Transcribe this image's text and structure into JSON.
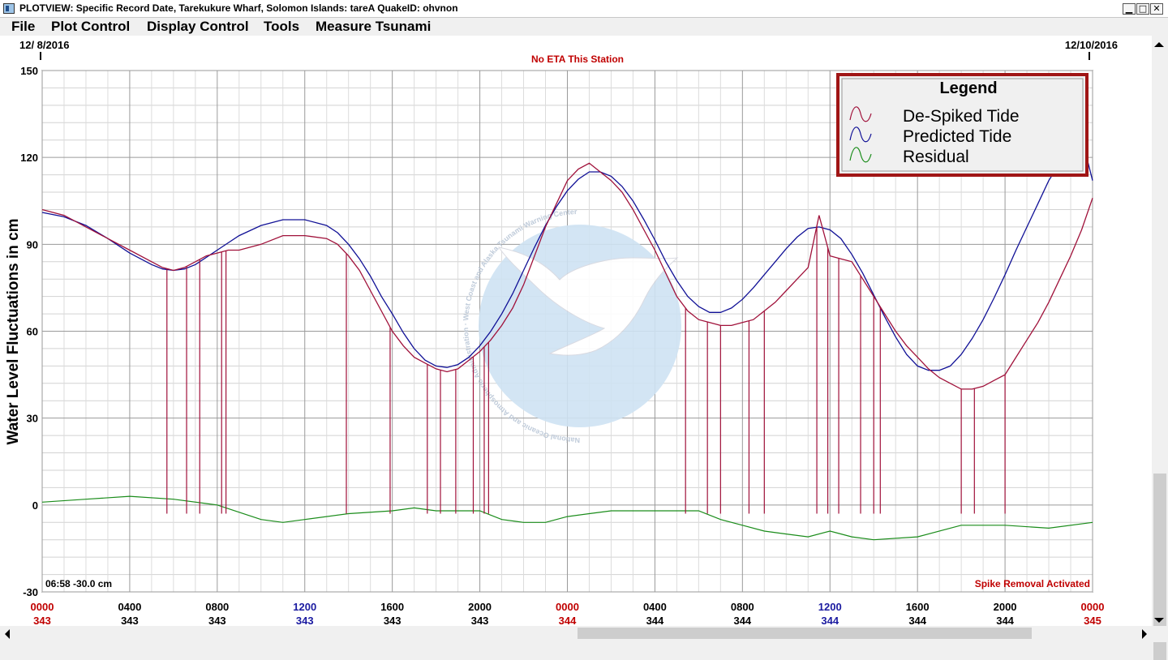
{
  "window": {
    "title": "PLOTVIEW: Specific Record Date, Tarekukure Wharf, Solomon Islands: tareA     QuakeID: ohvnon",
    "minimize_glyph": "▁",
    "maximize_glyph": "□",
    "close_glyph": "✕"
  },
  "menu": {
    "items": [
      "File",
      "Plot Control",
      "Display Control",
      "Tools",
      "Measure Tsunami"
    ]
  },
  "plot": {
    "start_date": "12/ 8/2016",
    "end_date": "12/10/2016",
    "eta_text": "No ETA This Station",
    "ylabel": "Water Level Fluctuations in cm",
    "cursor_readout": "06:58 -30.0 cm",
    "status_text": "Spike Removal Activated",
    "watermark_text": "National Oceanic and Atmospheric Administration · West Coast and Alaska Tsunami Warning Center",
    "colors": {
      "despiked": "#a0113a",
      "predicted": "#101096",
      "residual": "#1a8c1a",
      "red_text": "#c00000",
      "blue_text": "#1a1aa0",
      "legend_border": "#a01515",
      "watermark_blue": "#cfe3f3",
      "watermark_gray": "#d5d7df"
    }
  },
  "legend": {
    "title": "Legend",
    "entries": [
      "De-Spiked Tide",
      "Predicted Tide",
      "Residual"
    ]
  },
  "chart_data": {
    "type": "line",
    "xlabel": "",
    "ylabel": "Water Level Fluctuations in cm",
    "ylim": [
      -30,
      150
    ],
    "y_ticks": [
      "150",
      "120",
      "90",
      "60",
      "30",
      "0",
      "-30"
    ],
    "y_tick_values": [
      150,
      120,
      90,
      60,
      30,
      0,
      -30
    ],
    "x_range_hours": [
      0,
      48
    ],
    "x_ticks": [
      {
        "time": "0000",
        "day": "343",
        "time_color": "red",
        "day_color": "red"
      },
      {
        "time": "0400",
        "day": "343",
        "time_color": "black",
        "day_color": "black"
      },
      {
        "time": "0800",
        "day": "343",
        "time_color": "black",
        "day_color": "black"
      },
      {
        "time": "1200",
        "day": "343",
        "time_color": "blue",
        "day_color": "blue"
      },
      {
        "time": "1600",
        "day": "343",
        "time_color": "black",
        "day_color": "black"
      },
      {
        "time": "2000",
        "day": "343",
        "time_color": "black",
        "day_color": "black"
      },
      {
        "time": "0000",
        "day": "344",
        "time_color": "red",
        "day_color": "red"
      },
      {
        "time": "0400",
        "day": "344",
        "time_color": "black",
        "day_color": "black"
      },
      {
        "time": "0800",
        "day": "344",
        "time_color": "black",
        "day_color": "black"
      },
      {
        "time": "1200",
        "day": "344",
        "time_color": "blue",
        "day_color": "blue"
      },
      {
        "time": "1600",
        "day": "344",
        "time_color": "black",
        "day_color": "black"
      },
      {
        "time": "2000",
        "day": "344",
        "time_color": "black",
        "day_color": "black"
      },
      {
        "time": "0000",
        "day": "345",
        "time_color": "red",
        "day_color": "red"
      }
    ],
    "grid": true,
    "legend_position": "top-right",
    "series": [
      {
        "name": "De-Spiked Tide",
        "x": [
          0,
          1,
          2,
          3,
          4,
          5,
          5.5,
          6,
          6.5,
          7,
          7.5,
          8,
          8.5,
          9,
          10,
          11,
          12,
          13,
          13.5,
          14,
          14.5,
          15,
          15.5,
          16,
          16.5,
          17,
          17.5,
          18,
          18.5,
          19,
          19.5,
          20,
          20.5,
          21,
          21.5,
          22,
          22.5,
          23,
          23.5,
          24,
          24.5,
          25,
          25.5,
          26,
          26.5,
          27,
          27.5,
          28,
          28.5,
          29,
          29.5,
          30,
          30.5,
          31,
          31.5,
          32,
          32.5,
          33,
          33.5,
          34,
          34.5,
          35,
          35.5,
          36,
          36.5,
          37,
          37.5,
          38,
          38.5,
          39,
          39.5,
          40,
          40.5,
          41,
          41.5,
          42,
          42.5,
          43,
          43.5,
          44,
          44.5,
          45,
          45.5,
          46,
          46.5,
          47,
          47.5,
          48
        ],
        "values": [
          102,
          100,
          96,
          92,
          88,
          84,
          82,
          81,
          82,
          84,
          86,
          87,
          88,
          88,
          90,
          93,
          93,
          92,
          90,
          86,
          81,
          74,
          67,
          60,
          55,
          51,
          49,
          47,
          46,
          47,
          50,
          53,
          57,
          62,
          68,
          76,
          86,
          96,
          104,
          112,
          116,
          118,
          115,
          112,
          108,
          102,
          95,
          88,
          80,
          72,
          67,
          64,
          63,
          62,
          62,
          63,
          64,
          67,
          70,
          74,
          78,
          82,
          100,
          86,
          85,
          84,
          78,
          72,
          66,
          60,
          55,
          51,
          47,
          44,
          42,
          40,
          40,
          41,
          43,
          45,
          51,
          57,
          63,
          70,
          78,
          86,
          95,
          106
        ]
      },
      {
        "name": "Predicted Tide",
        "x": [
          0,
          1,
          2,
          3,
          4,
          5,
          5.5,
          6,
          6.5,
          7,
          7.5,
          8,
          8.5,
          9,
          10,
          11,
          12,
          13,
          13.5,
          14,
          14.5,
          15,
          15.5,
          16,
          16.5,
          17,
          17.5,
          18,
          18.5,
          19,
          19.5,
          20,
          20.5,
          21,
          21.5,
          22,
          22.5,
          23,
          23.5,
          24,
          24.5,
          25,
          25.5,
          26,
          26.5,
          27,
          27.5,
          28,
          28.5,
          29,
          29.5,
          30,
          30.5,
          31,
          31.5,
          32,
          32.5,
          33,
          33.5,
          34,
          34.5,
          35,
          35.5,
          36,
          36.5,
          37,
          37.5,
          38,
          38.5,
          39,
          39.5,
          40,
          40.5,
          41,
          41.5,
          42,
          42.5,
          43,
          43.5,
          44,
          44.5,
          45,
          45.5,
          46,
          46.5,
          47,
          47.5,
          48
        ],
        "values": [
          101,
          99.5,
          96.5,
          92,
          87,
          83,
          81.5,
          81,
          81.5,
          83,
          85.5,
          88,
          90.5,
          93,
          96.5,
          98.5,
          98.5,
          96.5,
          94,
          90,
          85,
          79,
          72,
          66,
          59.5,
          54,
          50,
          48,
          47.5,
          48.5,
          51,
          55,
          60,
          66,
          73,
          81,
          89,
          96.5,
          103,
          108.5,
          112.5,
          115,
          115,
          113.5,
          110,
          105,
          98.5,
          91.5,
          84,
          77.5,
          72,
          68.5,
          66.5,
          66.5,
          68,
          71,
          75,
          79.5,
          84,
          88.5,
          92.5,
          95.5,
          96,
          95,
          92,
          86.5,
          80,
          72.5,
          65,
          58,
          52,
          48,
          46.5,
          46.5,
          48,
          52,
          57.5,
          64,
          71.5,
          79.5,
          88,
          96,
          104,
          112,
          118,
          123,
          127,
          112
        ]
      },
      {
        "name": "Residual",
        "x": [
          0,
          2,
          4,
          6,
          8,
          10,
          11,
          12,
          14,
          16,
          17,
          18,
          19,
          20,
          21,
          22,
          23,
          24,
          25,
          26,
          27,
          28,
          30,
          31,
          32,
          33,
          34,
          35,
          36,
          37,
          38,
          40,
          42,
          44,
          46,
          48
        ],
        "values": [
          1,
          2,
          3,
          2,
          0,
          -5,
          -6,
          -5,
          -3,
          -2,
          -1,
          -2,
          -2,
          -2,
          -5,
          -6,
          -6,
          -4,
          -3,
          -2,
          -2,
          -2,
          -2,
          -5,
          -7,
          -9,
          -10,
          -11,
          -9,
          -11,
          -12,
          -11,
          -7,
          -7,
          -8,
          -6
        ]
      }
    ]
  }
}
